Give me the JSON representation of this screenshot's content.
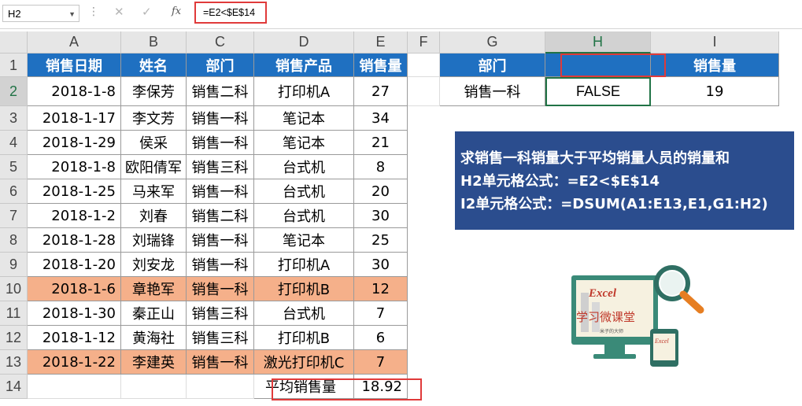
{
  "formula_bar": {
    "name_box": "H2",
    "formula": "=E2<$E$14",
    "fx_label": "fx"
  },
  "columns": [
    "A",
    "B",
    "C",
    "D",
    "E",
    "F",
    "G",
    "H",
    "I"
  ],
  "rows": [
    "1",
    "2",
    "3",
    "4",
    "5",
    "6",
    "7",
    "8",
    "9",
    "10",
    "11",
    "12",
    "13",
    "14"
  ],
  "table": {
    "headers": [
      "销售日期",
      "姓名",
      "部门",
      "销售产品",
      "销售量"
    ],
    "data": [
      [
        "2018-1-8",
        "李保芳",
        "销售二科",
        "打印机A",
        "27"
      ],
      [
        "2018-1-17",
        "李文芳",
        "销售一科",
        "笔记本",
        "34"
      ],
      [
        "2018-1-29",
        "侯采",
        "销售一科",
        "笔记本",
        "21"
      ],
      [
        "2018-1-8",
        "欧阳倩军",
        "销售三科",
        "台式机",
        "8"
      ],
      [
        "2018-1-25",
        "马来军",
        "销售一科",
        "台式机",
        "20"
      ],
      [
        "2018-1-2",
        "刘春",
        "销售二科",
        "台式机",
        "30"
      ],
      [
        "2018-1-28",
        "刘瑞锋",
        "销售一科",
        "笔记本",
        "25"
      ],
      [
        "2018-1-20",
        "刘安龙",
        "销售一科",
        "打印机A",
        "30"
      ],
      [
        "2018-1-6",
        "章艳军",
        "销售一科",
        "打印机B",
        "12"
      ],
      [
        "2018-1-30",
        "秦正山",
        "销售三科",
        "台式机",
        "7"
      ],
      [
        "2018-1-12",
        "黄海社",
        "销售三科",
        "打印机B",
        "6"
      ],
      [
        "2018-1-22",
        "李建英",
        "销售一科",
        "激光打印机C",
        "7"
      ]
    ],
    "average_label": "平均销售量",
    "average_value": "18.92"
  },
  "criteria": {
    "headers": [
      "部门",
      "",
      "销售量"
    ],
    "values": [
      "销售一科",
      "FALSE",
      "19"
    ]
  },
  "info": {
    "line1": "求销售一科销量大于平均销量人员的销量和",
    "line2": "H2单元格公式：=E2<$E$14",
    "line3": "I2单元格公式：=DSUM(A1:E13,E1,G1:H2)"
  },
  "logo": {
    "title": "Excel",
    "subtitle": "学习微课堂",
    "tag": "米子的大师",
    "phone_text": "Excel"
  },
  "colors": {
    "header_blue": "#1f70c1",
    "highlight": "#f5b08a",
    "info_bg": "#2b4d8e",
    "accent_red": "#e03a3a"
  }
}
